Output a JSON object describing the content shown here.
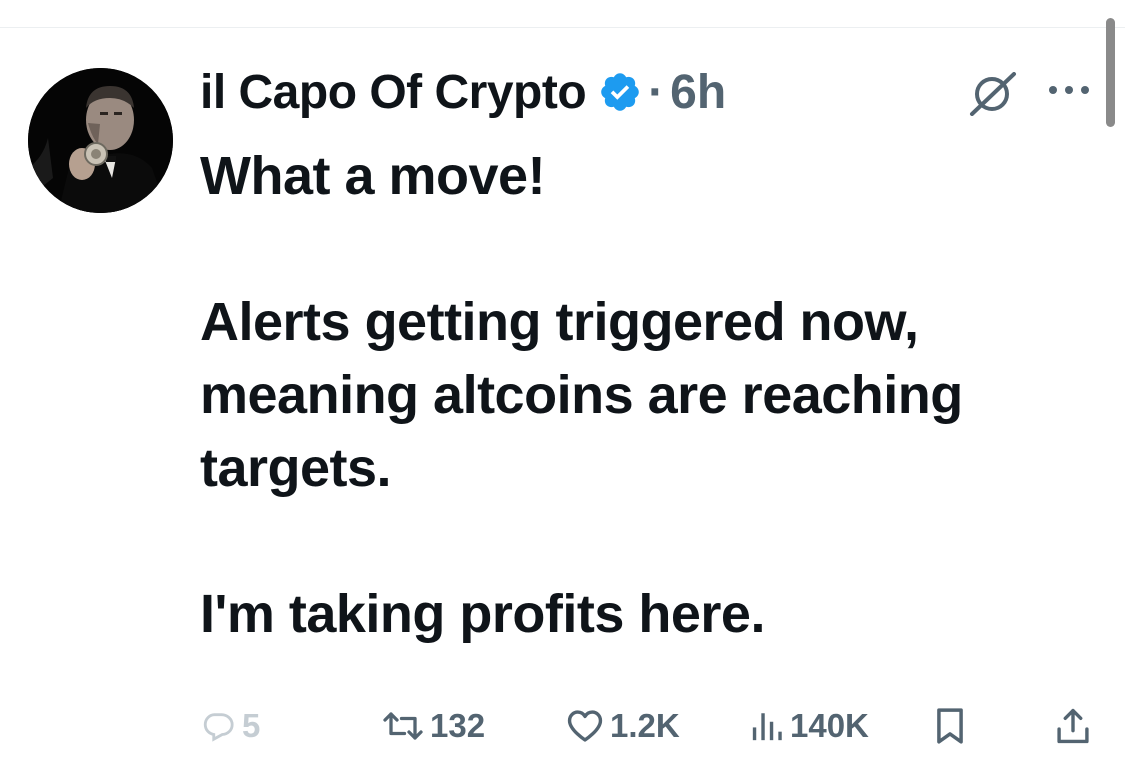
{
  "post": {
    "author_name": "il Capo Of Crypto",
    "separator": "·",
    "time": "6h",
    "text_lines": [
      "What a move!",
      "",
      "Alerts getting triggered now,",
      "meaning altcoins are reaching",
      "targets.",
      "",
      "I'm taking profits here."
    ],
    "line1": "What a move!",
    "line2": "Alerts getting triggered now,",
    "line3": "meaning altcoins are reaching",
    "line4": "targets.",
    "line5": "I'm taking profits here."
  },
  "actions": {
    "replies": "5",
    "reposts": "132",
    "likes": "1.2K",
    "views": "140K"
  },
  "icons": {
    "verified": "verified-badge-icon",
    "grok": "grok-icon",
    "more": "more-icon",
    "reply": "reply-icon",
    "repost": "repost-icon",
    "like": "heart-icon",
    "views": "views-icon",
    "bookmark": "bookmark-icon",
    "share": "share-icon"
  },
  "colors": {
    "text": "#0f1419",
    "muted": "#536471",
    "verified": "#1d9bf0",
    "reply_faded": "#c5cdd3"
  }
}
